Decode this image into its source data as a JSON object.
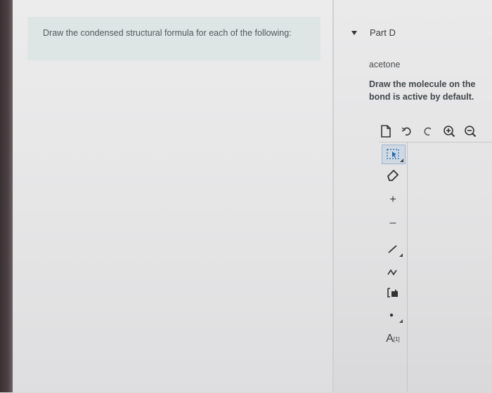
{
  "question": {
    "prompt": "Draw the condensed structural formula for each of the following:"
  },
  "part": {
    "title": "Part D",
    "compound": "acetone",
    "instruction_line1": "Draw the molecule on the",
    "instruction_line2": "bond is active by default."
  },
  "toolbar_top": {
    "items": [
      "new-document-icon",
      "undo-icon",
      "redo-icon",
      "zoom-in-icon",
      "zoom-out-icon"
    ]
  },
  "toolbar_side": {
    "items": [
      "select-icon",
      "eraser-icon",
      "plus-charge-icon",
      "minus-charge-icon",
      "single-bond-icon",
      "chain-icon",
      "template-ring-icon",
      "radical-dot-icon",
      "atom-label-icon"
    ],
    "plus_glyph": "+",
    "minus_glyph": "–",
    "atom_letter": "A",
    "atom_superscript": "[1]"
  },
  "colors": {
    "prompt_box": "#dde5e5",
    "selected_tool": "#cfd9e4"
  }
}
